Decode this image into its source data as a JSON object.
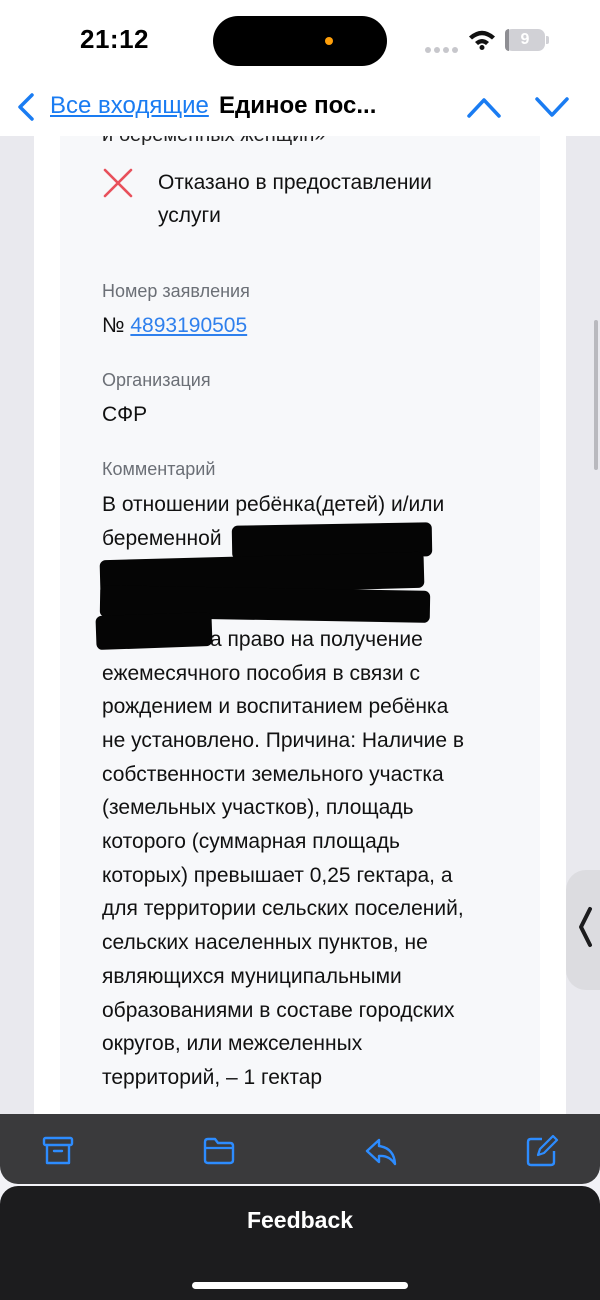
{
  "status_bar": {
    "time": "21:12",
    "battery_level": "9",
    "battery_fraction": 0.09
  },
  "nav": {
    "back_label": "Все входящие",
    "title": "Единое пос..."
  },
  "email": {
    "cut_off_text": "и беременных женщин»",
    "status_text": "Отказано в предоставлении услуги",
    "application_number_label": "Номер заявления",
    "application_number_prefix": "№",
    "application_number": "4893190505",
    "organization_label": "Организация",
    "organization": "СФР",
    "comment_label": "Комментарий",
    "comment_lines": [
      "В отношении ребёнка(детей) и/или",
      "беременной",
      "",
      "",
      "а право на получение",
      "ежемесячного пособия в связи с",
      "рождением и воспитанием ребёнка",
      "не установлено. Причина: Наличие в",
      "собственности земельного участка",
      "(земельных участков), площадь",
      "которого (суммарная площадь",
      "которых) превышает 0,25 гектара, а",
      "для территории сельских поселений,",
      "сельских населенных пунктов, не",
      "являющихся муниципальными",
      "образованиями в составе городских",
      "округов, или межселенных",
      "территорий, – 1 гектар"
    ]
  },
  "toolbar": {
    "icons": [
      "archive-icon",
      "folder-icon",
      "reply-icon",
      "compose-icon"
    ]
  },
  "feedback": {
    "label": "Feedback"
  },
  "colors": {
    "accent": "#1a7cf2",
    "link": "#2f80ed",
    "reject": "#e8505b",
    "toolbar_icon": "#2d8cff"
  }
}
